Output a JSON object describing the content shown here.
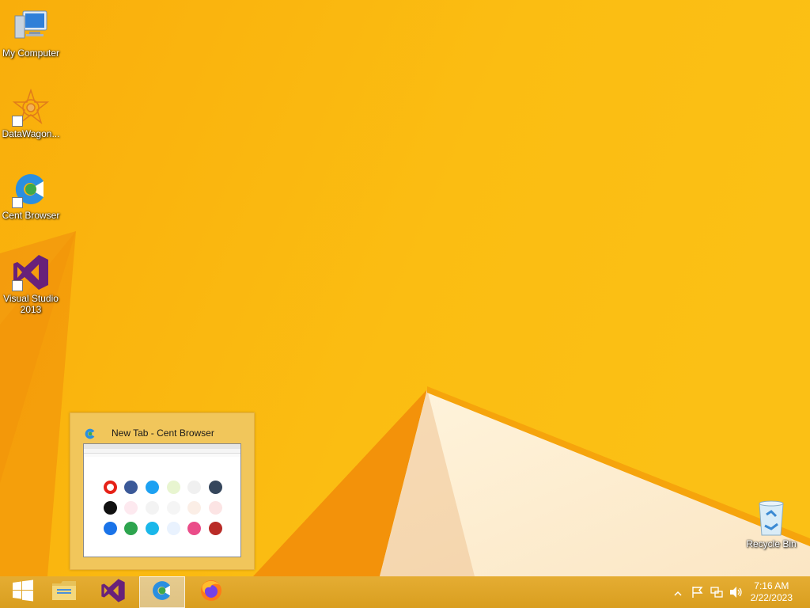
{
  "desktop": {
    "icons": [
      {
        "label": "My Computer",
        "icon": "computer-icon"
      },
      {
        "label": "DataWagon...",
        "icon": "datawagon-icon"
      },
      {
        "label": "Cent Browser",
        "icon": "cent-browser-icon"
      },
      {
        "label": "Visual Studio 2013",
        "icon": "visual-studio-icon"
      },
      {
        "label": "Recycle Bin",
        "icon": "recycle-bin-icon"
      }
    ]
  },
  "preview": {
    "title": "New Tab - Cent Browser",
    "icon": "cent-browser-icon"
  },
  "taskbar": {
    "buttons": [
      {
        "name": "start-button",
        "icon": "windows-logo-icon"
      },
      {
        "name": "file-explorer-button",
        "icon": "folder-icon"
      },
      {
        "name": "visual-studio-button",
        "icon": "visual-studio-icon"
      },
      {
        "name": "cent-browser-button",
        "icon": "cent-browser-icon",
        "active": true
      },
      {
        "name": "firefox-button",
        "icon": "firefox-icon"
      }
    ],
    "tray": {
      "icons": [
        "show-hidden-icons-icon",
        "action-center-flag-icon",
        "network-icon",
        "volume-icon"
      ]
    },
    "clock": {
      "time": "7:16 AM",
      "date": "2/22/2023"
    }
  },
  "colors": {
    "wallpaper": "#f8b40e",
    "taskbar": "#e0a62a",
    "preview_bg": "#f1c65b"
  }
}
